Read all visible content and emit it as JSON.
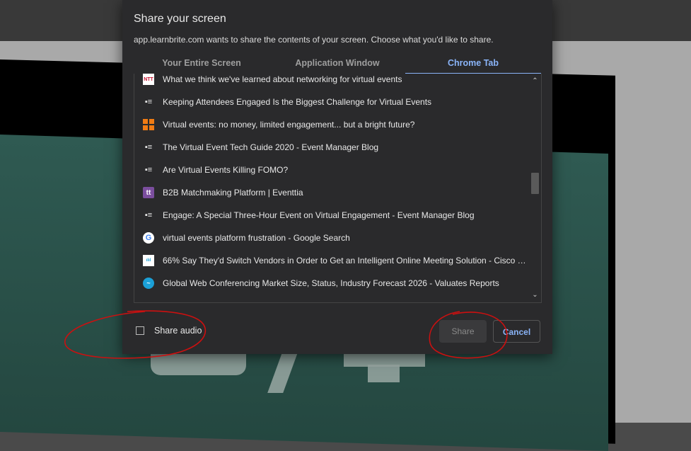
{
  "dialog": {
    "title": "Share your screen",
    "subtitle": "app.learnbrite.com wants to share the contents of your screen. Choose what you'd like to share."
  },
  "tabs": [
    {
      "label": "Your Entire Screen",
      "active": false
    },
    {
      "label": "Application Window",
      "active": false
    },
    {
      "label": "Chrome Tab",
      "active": true
    }
  ],
  "tab_list": [
    {
      "icon": "ntt-favicon-icon",
      "title": "What we think we've learned about networking for virtual events"
    },
    {
      "icon": "event-manager-favicon-icon",
      "title": "Keeping Attendees Engaged Is the Biggest Challenge for Virtual Events"
    },
    {
      "icon": "orange-grid-favicon-icon",
      "title": "Virtual events: no money, limited engagement... but a bright future?"
    },
    {
      "icon": "event-manager-favicon-icon",
      "title": "The Virtual Event Tech Guide 2020 - Event Manager Blog"
    },
    {
      "icon": "event-manager-favicon-icon",
      "title": "Are Virtual Events Killing FOMO?"
    },
    {
      "icon": "eventtia-favicon-icon",
      "title": "B2B Matchmaking Platform | Eventtia"
    },
    {
      "icon": "event-manager-favicon-icon",
      "title": "Engage: A Special Three-Hour Event on Virtual Engagement - Event Manager Blog"
    },
    {
      "icon": "google-favicon-icon",
      "title": "virtual events platform frustration - Google Search"
    },
    {
      "icon": "cisco-favicon-icon",
      "title": "66% Say They'd Switch Vendors in Order to Get an Intelligent Online Meeting Solution - Cisco Bl..."
    },
    {
      "icon": "valuates-favicon-icon",
      "title": "Global Web Conferencing Market Size, Status, Industry Forecast 2026 - Valuates Reports"
    }
  ],
  "share_audio": {
    "label": "Share audio",
    "checked": false
  },
  "buttons": {
    "share": "Share",
    "cancel": "Cancel"
  },
  "colors": {
    "accent": "#8ab4f8",
    "dialog_bg": "#2a2a2c",
    "annotation": "#cc1010"
  }
}
